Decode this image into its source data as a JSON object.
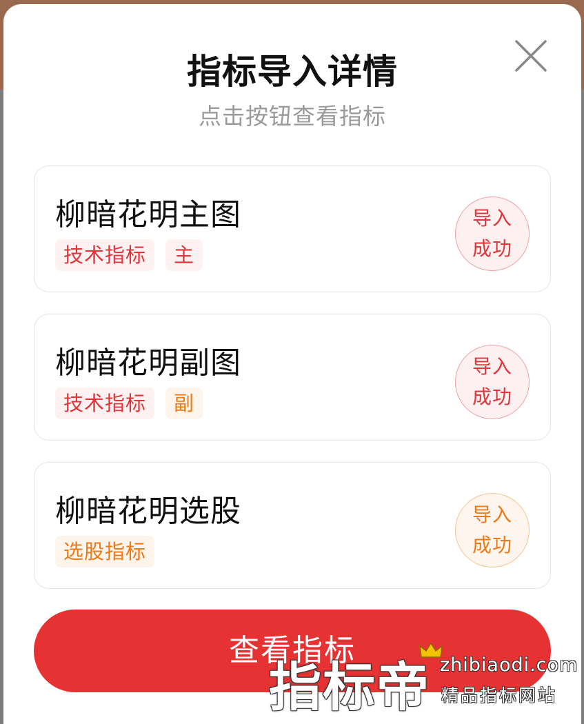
{
  "dialog": {
    "title": "指标导入详情",
    "subtitle": "点击按钮查看指标",
    "close_icon": "close-icon"
  },
  "items": [
    {
      "name": "柳暗花明主图",
      "tags": [
        {
          "label": "技术指标",
          "color": "red"
        },
        {
          "label": "主",
          "color": "red"
        }
      ],
      "status": {
        "line1": "导入",
        "line2": "成功",
        "color": "red"
      }
    },
    {
      "name": "柳暗花明副图",
      "tags": [
        {
          "label": "技术指标",
          "color": "red"
        },
        {
          "label": "副",
          "color": "orange"
        }
      ],
      "status": {
        "line1": "导入",
        "line2": "成功",
        "color": "red"
      }
    },
    {
      "name": "柳暗花明选股",
      "tags": [
        {
          "label": "选股指标",
          "color": "orange"
        }
      ],
      "status": {
        "line1": "导入",
        "line2": "成功",
        "color": "orange"
      }
    }
  ],
  "primary_button": {
    "label": "查看指标"
  },
  "watermark": {
    "brand": "指标帝",
    "url": "zhibiaodi.com",
    "slogan": "精品指标网站"
  },
  "colors": {
    "accent_red": "#e63232",
    "tag_red": "#e0353a",
    "tag_orange": "#ec7a18"
  }
}
